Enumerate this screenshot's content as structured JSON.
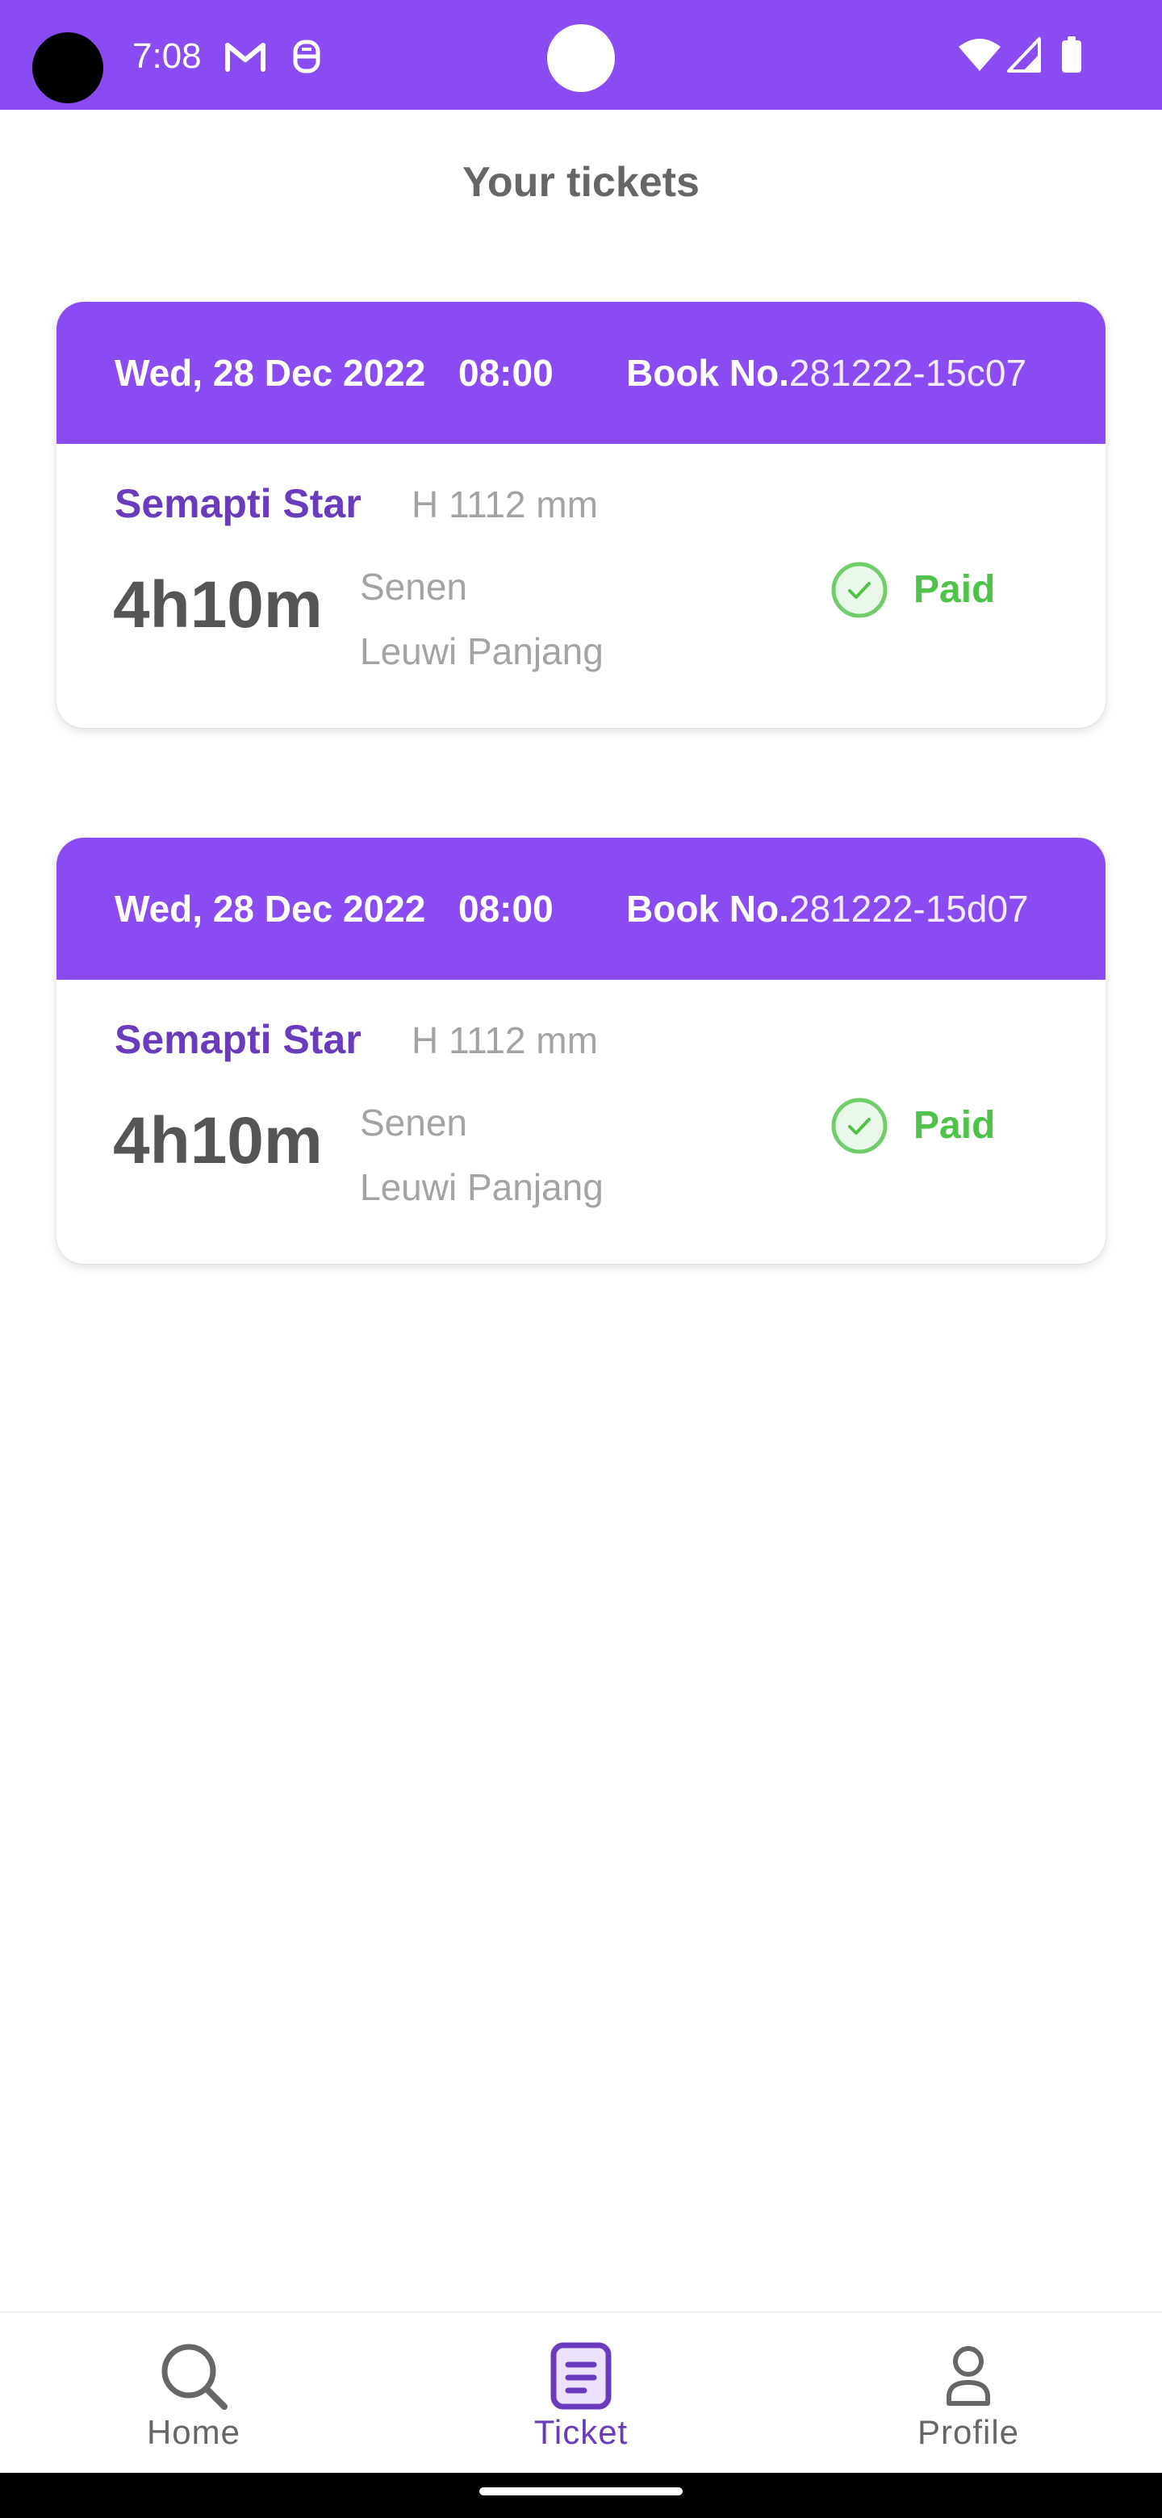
{
  "status_bar": {
    "time": "7:08",
    "notification_icons": [
      "gmail-icon",
      "app-notification-icon"
    ],
    "system_icons": [
      "wifi-icon",
      "cellular-signal-icon",
      "battery-icon"
    ],
    "background_color": "#8a4cf2"
  },
  "page": {
    "title": "Your tickets"
  },
  "tickets": [
    {
      "date": "Wed, 28 Dec 2022",
      "time": "08:00",
      "book_label": "Book No.",
      "book_number": "281222-15c07",
      "train_name": "Semapti Star",
      "train_class": "H 1112 mm",
      "duration": "4h10m",
      "origin": "Senen",
      "destination": "Leuwi Panjang",
      "status": "Paid",
      "status_icon": "check-circle-icon"
    },
    {
      "date": "Wed, 28 Dec 2022",
      "time": "08:00",
      "book_label": "Book No.",
      "book_number": "281222-15d07",
      "train_name": "Semapti Star",
      "train_class": "H 1112 mm",
      "duration": "4h10m",
      "origin": "Senen",
      "destination": "Leuwi Panjang",
      "status": "Paid",
      "status_icon": "check-circle-icon"
    }
  ],
  "bottom_nav": {
    "items": [
      {
        "label": "Home",
        "icon": "search-icon",
        "active": false
      },
      {
        "label": "Ticket",
        "icon": "ticket-icon",
        "active": true
      },
      {
        "label": "Profile",
        "icon": "person-icon",
        "active": false
      }
    ],
    "active_color": "#6a3bbd",
    "inactive_color": "#666666"
  },
  "colors": {
    "primary": "#8a4cf2",
    "primary_dark_text": "#6a3bbd",
    "paid_green": "#4fc24a"
  }
}
